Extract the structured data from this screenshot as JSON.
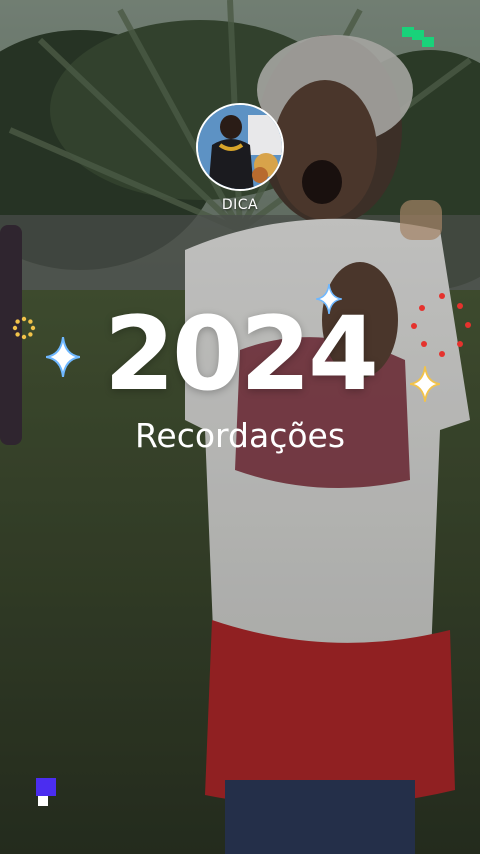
{
  "story": {
    "profile": {
      "name": "DICA"
    },
    "recap": {
      "year": "2024",
      "subtitle": "Recordações"
    },
    "icons": {
      "logo": "brand-pixel-logo",
      "sparkles": [
        "sparkle-icon-left",
        "sparkle-icon-top",
        "sparkle-icon-right"
      ],
      "sun": "sun-ring-icon",
      "dots": "red-dot-arc",
      "corner": "pixel-corner-icon"
    },
    "colors": {
      "text": "#ffffff",
      "logo_green": "#19d27a",
      "sparkle_blue": "#6fb8ff",
      "sparkle_gold": "#f2c34a",
      "dot_red": "#e5322d",
      "corner_purple": "#4b2df0"
    }
  }
}
